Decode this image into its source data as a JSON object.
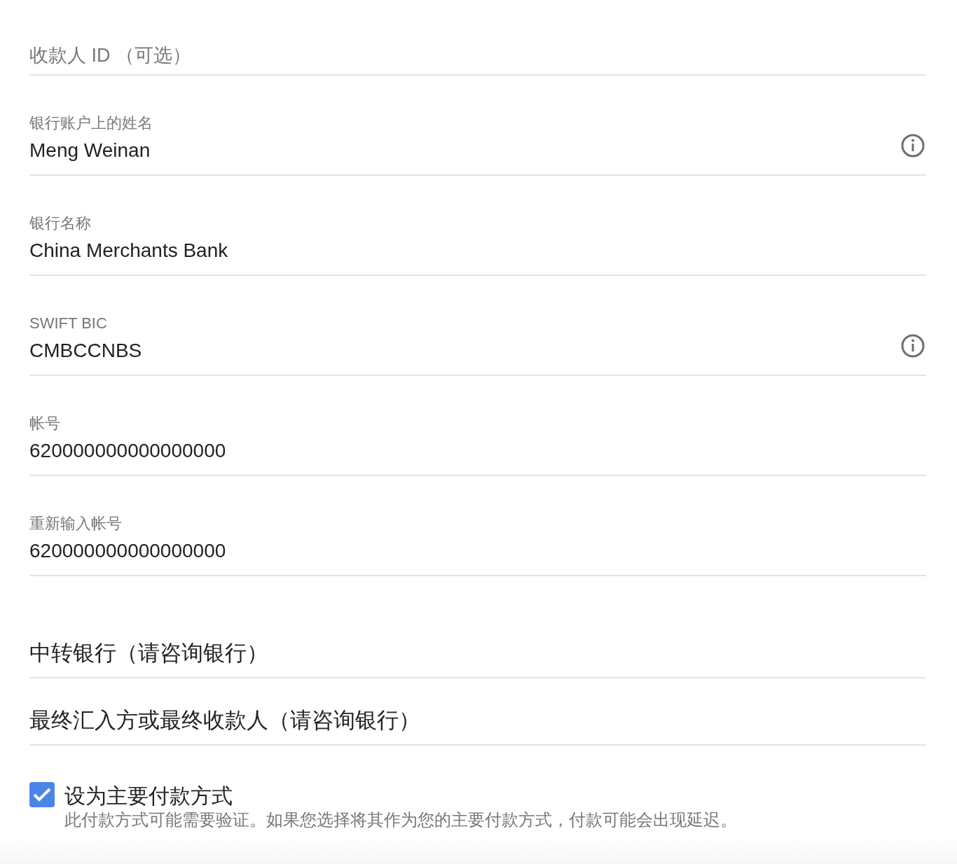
{
  "fields": [
    {
      "kind": "placeholder",
      "placeholder": "收款人 ID （可选）"
    },
    {
      "kind": "filled",
      "label": "银行账户上的姓名",
      "value": "Meng Weinan",
      "info": true
    },
    {
      "kind": "filled",
      "label": "银行名称",
      "value": "China Merchants Bank"
    },
    {
      "kind": "filled",
      "label": "SWIFT BIC",
      "value": "CMBCCNBS",
      "info": true
    },
    {
      "kind": "filled",
      "label": "帐号",
      "value": "620000000000000000"
    },
    {
      "kind": "filled",
      "label": "重新输入帐号",
      "value": "620000000000000000"
    },
    {
      "kind": "heading",
      "label": "中转银行（请咨询银行）"
    },
    {
      "kind": "heading",
      "label": "最终汇入方或最终收款人（请咨询银行）"
    }
  ],
  "primary": {
    "label": "设为主要付款方式",
    "checked": true,
    "description": "此付款方式可能需要验证。如果您选择将其作为您的主要付款方式，付款可能会出现延迟。"
  }
}
